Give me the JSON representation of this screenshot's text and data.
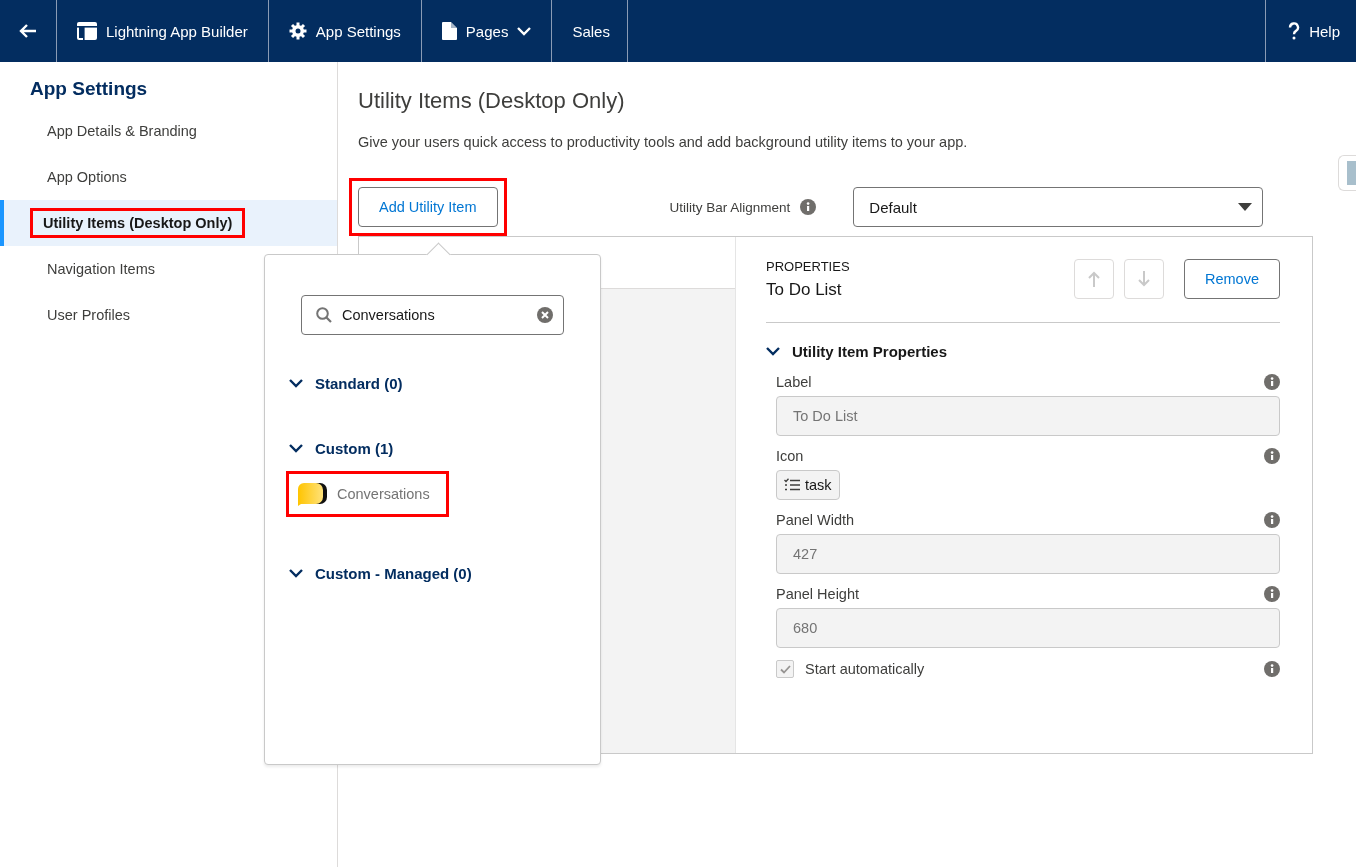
{
  "topbar": {
    "items": [
      {
        "kind": "builder",
        "label": "Lightning App Builder"
      },
      {
        "kind": "settings",
        "label": "App Settings"
      },
      {
        "kind": "pages",
        "label": "Pages"
      },
      {
        "kind": "app",
        "label": "Sales"
      }
    ],
    "help": "Help"
  },
  "sidebar": {
    "title": "App Settings",
    "items": [
      {
        "label": "App Details & Branding",
        "selected": false,
        "highlighted": false
      },
      {
        "label": "App Options",
        "selected": false,
        "highlighted": false
      },
      {
        "label": "Utility Items (Desktop Only)",
        "selected": true,
        "highlighted": true
      },
      {
        "label": "Navigation Items",
        "selected": false,
        "highlighted": false
      },
      {
        "label": "User Profiles",
        "selected": false,
        "highlighted": false
      }
    ]
  },
  "main": {
    "title": "Utility Items (Desktop Only)",
    "description": "Give your users quick access to productivity tools and add background utility items to your app.",
    "add_button": {
      "label": "Add Utility Item",
      "highlighted": true
    },
    "alignment": {
      "label": "Utility Bar Alignment",
      "value": "Default"
    }
  },
  "popover": {
    "search": {
      "value": "Conversations"
    },
    "groups": [
      {
        "title": "Standard (0)",
        "expanded": true
      },
      {
        "title": "Custom (1)",
        "expanded": true,
        "items": [
          {
            "label": "Conversations",
            "highlighted": true
          }
        ]
      },
      {
        "title": "Custom - Managed (0)",
        "expanded": true
      }
    ]
  },
  "properties": {
    "heading": "PROPERTIES",
    "item_name": "To Do List",
    "remove": "Remove",
    "section": {
      "title": "Utility Item Properties",
      "expanded": true
    },
    "fields": [
      {
        "kind": "text",
        "label": "Label",
        "value": "To Do List",
        "disabled": true
      },
      {
        "kind": "icon",
        "label": "Icon",
        "value": "task"
      },
      {
        "kind": "text",
        "label": "Panel Width",
        "value": "427",
        "disabled": true
      },
      {
        "kind": "text",
        "label": "Panel Height",
        "value": "680",
        "disabled": true
      },
      {
        "kind": "checkbox",
        "label": "Start automatically",
        "checked": true,
        "disabled": true
      }
    ]
  }
}
